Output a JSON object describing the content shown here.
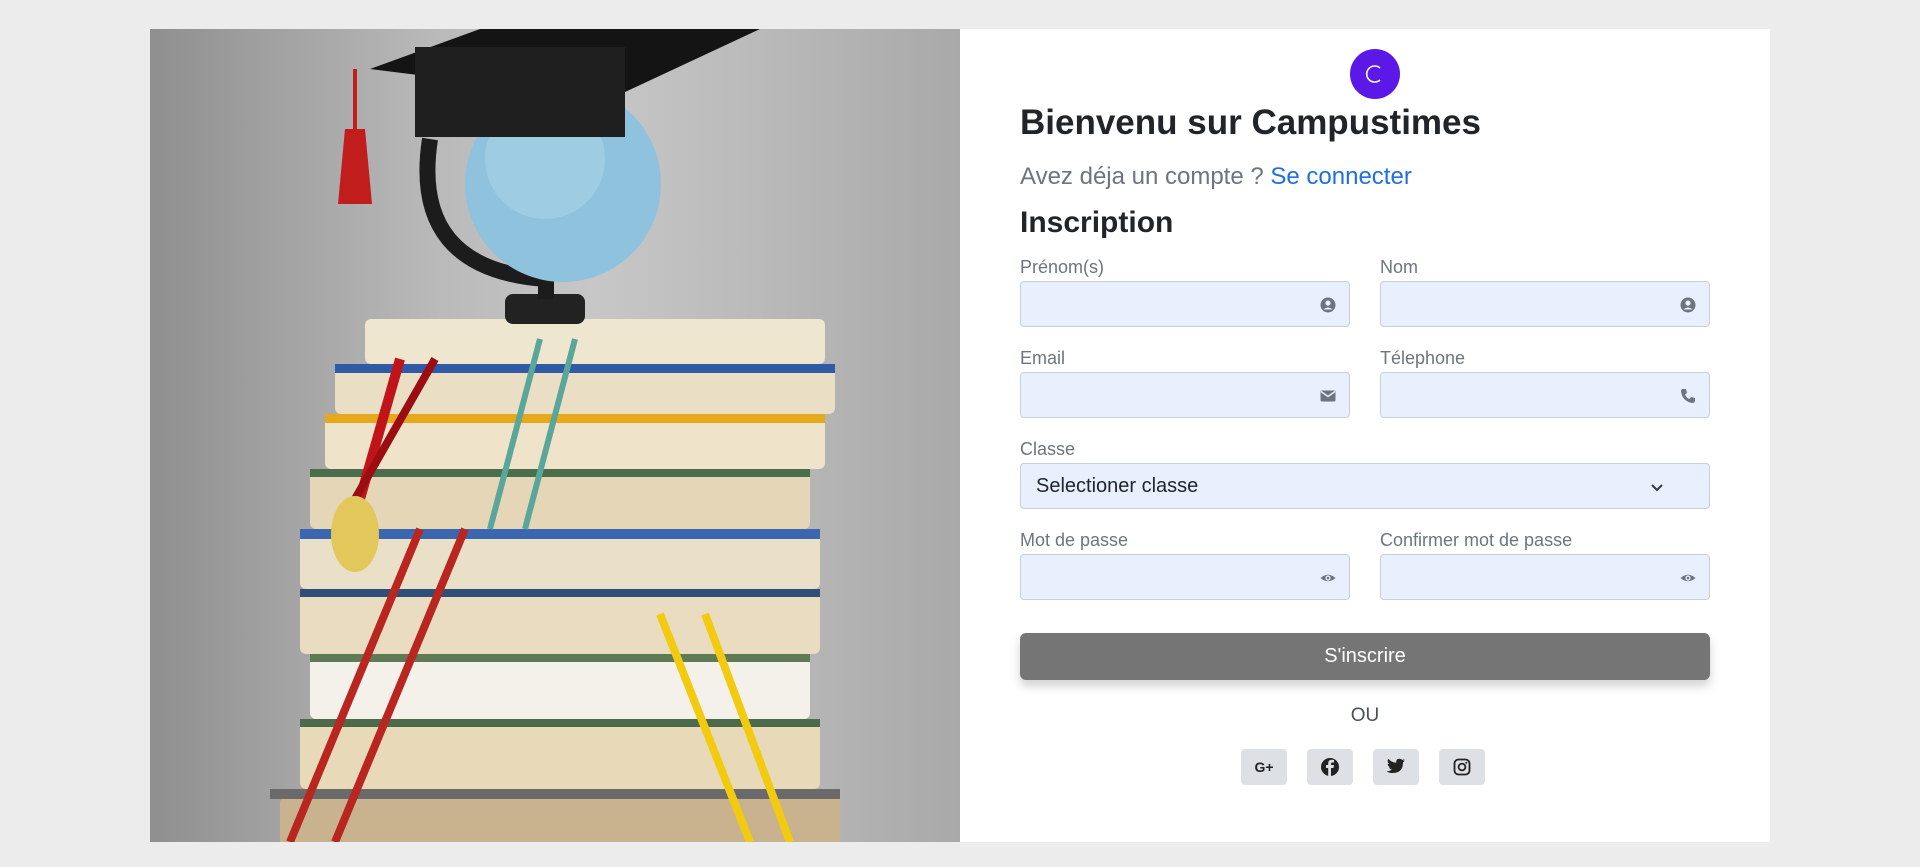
{
  "brand": {
    "logo_glyph": "C",
    "accent": "#5b18e6"
  },
  "header": {
    "title": "Bienvenu sur Campustimes",
    "subtitle": "Avez déja un compte ?",
    "login_link": "Se connecter"
  },
  "form": {
    "heading": "Inscription",
    "firstname": {
      "label": "Prénom(s)",
      "value": "",
      "icon": "user-circle-icon"
    },
    "lastname": {
      "label": "Nom",
      "value": "",
      "icon": "user-circle-icon"
    },
    "email": {
      "label": "Email",
      "value": "",
      "icon": "envelope-icon"
    },
    "phone": {
      "label": "Télephone",
      "value": "",
      "icon": "phone-icon"
    },
    "classe": {
      "label": "Classe",
      "selected": "Selectioner classe"
    },
    "password": {
      "label": "Mot de passe",
      "value": "",
      "icon": "eye-icon"
    },
    "confirm_password": {
      "label": "Confirmer mot de passe",
      "value": "",
      "icon": "eye-icon"
    },
    "submit_label": "S'inscrire",
    "separator": "OU"
  },
  "social": [
    {
      "name": "google-plus",
      "glyph": "G+"
    },
    {
      "name": "facebook",
      "glyph": "f"
    },
    {
      "name": "twitter",
      "glyph": "twitter-bird"
    },
    {
      "name": "instagram",
      "glyph": "camera"
    }
  ],
  "colors": {
    "field_bg": "#e8f0fe",
    "button_bg": "#757575",
    "link": "#1f6fe0",
    "page_bg": "#ececec"
  }
}
